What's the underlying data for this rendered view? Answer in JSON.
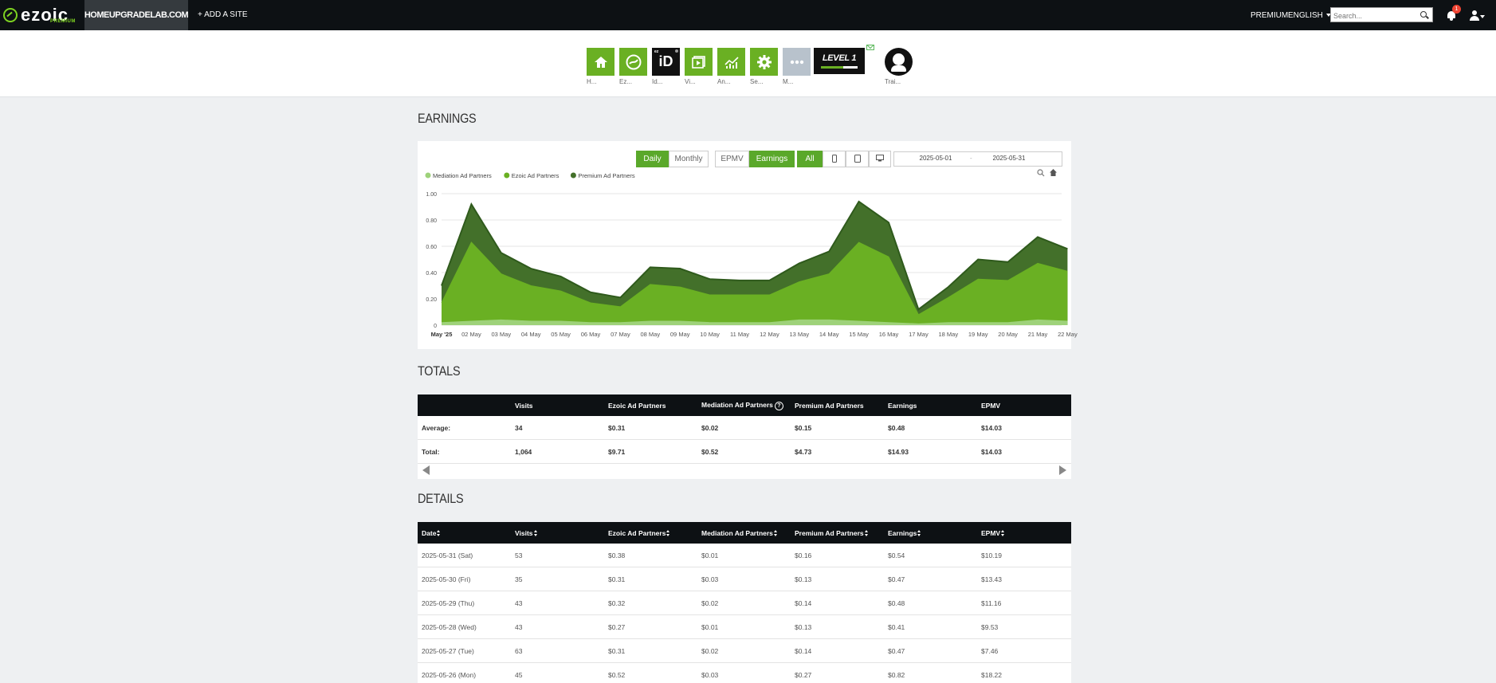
{
  "topbar": {
    "logo": "ezoic",
    "logo_sub": "PREMIUM",
    "site": "HOMEUPGRADELAB.COM",
    "add_site": "+ ADD A SITE",
    "premium": "PREMIUM",
    "language": "ENGLISH",
    "search_placeholder": "Search...",
    "notification_count": "1"
  },
  "apps": [
    {
      "label": "H...",
      "icon": "home-icon"
    },
    {
      "label": "Ez...",
      "icon": "ezoic-swirl-icon"
    },
    {
      "label": "Id...",
      "icon": "id-icon",
      "tile_text": "iD",
      "tile_sub": "ez"
    },
    {
      "label": "Vi...",
      "icon": "video-icon"
    },
    {
      "label": "An...",
      "icon": "analytics-icon"
    },
    {
      "label": "Se...",
      "icon": "gear-icon"
    },
    {
      "label": "M...",
      "icon": "more-icon"
    }
  ],
  "level_badge": "LEVEL 1",
  "level_progress": 0.6,
  "trainer": {
    "label": "Trai..."
  },
  "earnings": {
    "title": "EARNINGS",
    "period_buttons": [
      "Daily",
      "Monthly"
    ],
    "metric_buttons": [
      "EPMV",
      "Earnings"
    ],
    "device_all": "All",
    "date_from": "2025-05-01",
    "date_to": "2025-05-31",
    "date_sep": "-"
  },
  "chart_data": {
    "type": "area",
    "stacked": true,
    "categories": [
      "May '25",
      "02 May",
      "03 May",
      "04 May",
      "05 May",
      "06 May",
      "07 May",
      "08 May",
      "09 May",
      "10 May",
      "11 May",
      "12 May",
      "13 May",
      "14 May",
      "15 May",
      "16 May",
      "17 May",
      "18 May",
      "19 May",
      "20 May",
      "21 May",
      "22 May"
    ],
    "yticks": [
      "0",
      "0.20",
      "0.40",
      "0.60",
      "0.80",
      "1.00"
    ],
    "ylim": [
      0,
      1.0
    ],
    "legend_position": "top-left",
    "grid": true,
    "series": [
      {
        "name": "Mediation Ad Partners",
        "color": "#9ed27a",
        "values": [
          0.02,
          0.03,
          0.04,
          0.03,
          0.03,
          0.02,
          0.02,
          0.03,
          0.03,
          0.02,
          0.02,
          0.02,
          0.04,
          0.04,
          0.03,
          0.02,
          0.01,
          0.02,
          0.02,
          0.02,
          0.04,
          0.03
        ]
      },
      {
        "name": "Ezoic Ad Partners",
        "color": "#6ab023",
        "values": [
          0.15,
          0.6,
          0.35,
          0.27,
          0.23,
          0.15,
          0.12,
          0.28,
          0.26,
          0.21,
          0.21,
          0.21,
          0.29,
          0.35,
          0.6,
          0.5,
          0.07,
          0.19,
          0.33,
          0.32,
          0.43,
          0.38
        ]
      },
      {
        "name": "Premium Ad Partners",
        "color": "#43702a",
        "values": [
          0.13,
          0.29,
          0.16,
          0.13,
          0.11,
          0.08,
          0.07,
          0.13,
          0.14,
          0.12,
          0.11,
          0.11,
          0.14,
          0.17,
          0.31,
          0.26,
          0.04,
          0.08,
          0.15,
          0.14,
          0.2,
          0.17
        ]
      }
    ]
  },
  "totals": {
    "title": "TOTALS",
    "headers": [
      "",
      "Visits",
      "Ezoic Ad Partners",
      "Mediation Ad Partners",
      "Premium Ad Partners",
      "Earnings",
      "EPMV"
    ],
    "help_glyph": "?",
    "rows": [
      [
        "Average:",
        "34",
        "$0.31",
        "$0.02",
        "$0.15",
        "$0.48",
        "$14.03"
      ],
      [
        "Total:",
        "1,064",
        "$9.71",
        "$0.52",
        "$4.73",
        "$14.93",
        "$14.03"
      ]
    ]
  },
  "details": {
    "title": "DETAILS",
    "headers": [
      "Date",
      "Visits",
      "Ezoic Ad Partners",
      "Mediation Ad Partners",
      "Premium Ad Partners",
      "Earnings",
      "EPMV"
    ],
    "rows": [
      [
        "2025-05-31 (Sat)",
        "53",
        "$0.38",
        "$0.01",
        "$0.16",
        "$0.54",
        "$10.19"
      ],
      [
        "2025-05-30 (Fri)",
        "35",
        "$0.31",
        "$0.03",
        "$0.13",
        "$0.47",
        "$13.43"
      ],
      [
        "2025-05-29 (Thu)",
        "43",
        "$0.32",
        "$0.02",
        "$0.14",
        "$0.48",
        "$11.16"
      ],
      [
        "2025-05-28 (Wed)",
        "43",
        "$0.27",
        "$0.01",
        "$0.13",
        "$0.41",
        "$9.53"
      ],
      [
        "2025-05-27 (Tue)",
        "63",
        "$0.31",
        "$0.02",
        "$0.14",
        "$0.47",
        "$7.46"
      ],
      [
        "2025-05-26 (Mon)",
        "45",
        "$0.52",
        "$0.03",
        "$0.27",
        "$0.82",
        "$18.22"
      ]
    ]
  }
}
